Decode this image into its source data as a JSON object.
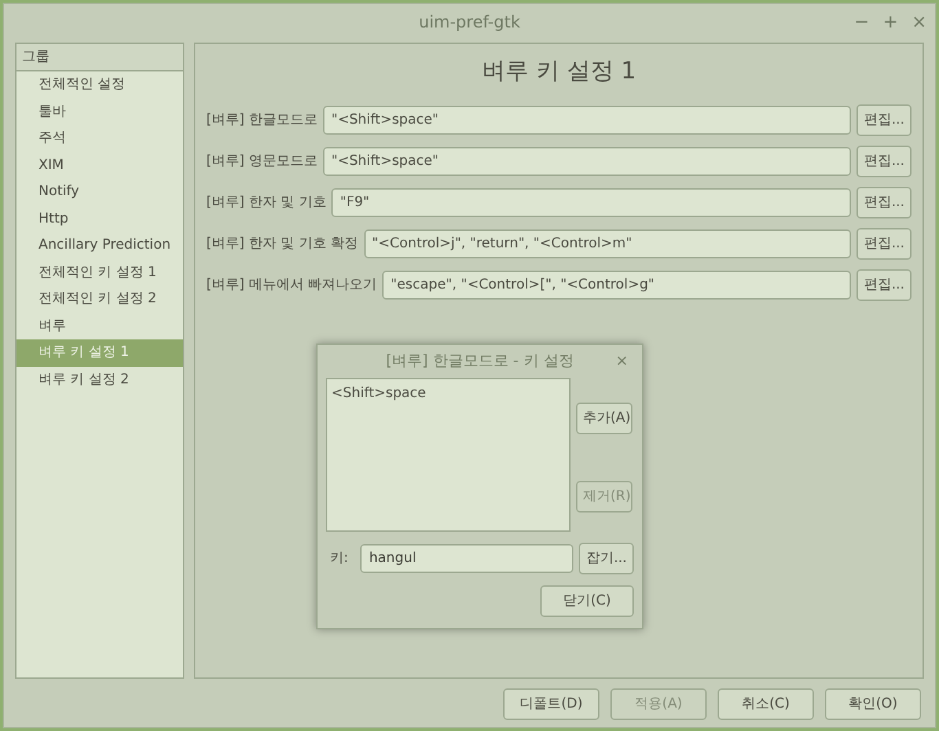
{
  "window": {
    "title": "uim-pref-gtk",
    "controls": [
      "−",
      "+",
      "×"
    ]
  },
  "sidebar": {
    "header": "그룹",
    "items": [
      {
        "label": "전체적인 설정",
        "selected": false
      },
      {
        "label": "툴바",
        "selected": false
      },
      {
        "label": "주석",
        "selected": false
      },
      {
        "label": "XIM",
        "selected": false
      },
      {
        "label": "Notify",
        "selected": false
      },
      {
        "label": "Http",
        "selected": false
      },
      {
        "label": "Ancillary Prediction",
        "selected": false
      },
      {
        "label": "전체적인 키 설정 1",
        "selected": false
      },
      {
        "label": "전체적인 키 설정 2",
        "selected": false
      },
      {
        "label": "벼루",
        "selected": false
      },
      {
        "label": "벼루 키 설정 1",
        "selected": true
      },
      {
        "label": "벼루 키 설정 2",
        "selected": false
      }
    ]
  },
  "main": {
    "heading": "벼루 키 설정 1",
    "settings": [
      {
        "label": "[벼루] 한글모드로",
        "value": "\"<Shift>space\"",
        "button": "편집..."
      },
      {
        "label": "[벼루] 영문모드로",
        "value": "\"<Shift>space\"",
        "button": "편집..."
      },
      {
        "label": "[벼루] 한자 및 기호",
        "value": "\"F9\"",
        "button": "편집..."
      },
      {
        "label": "[벼루] 한자 및 기호 확정",
        "value": "\"<Control>j\", \"return\", \"<Control>m\"",
        "button": "편집..."
      },
      {
        "label": "[벼루] 메뉴에서 빠져나오기",
        "value": "\"escape\", \"<Control>[\", \"<Control>g\"",
        "button": "편집..."
      }
    ]
  },
  "dialog": {
    "title": "[벼루] 한글모드로 - 키 설정",
    "close": "×",
    "keys": [
      "<Shift>space"
    ],
    "side_buttons": [
      {
        "label": "추가(A)",
        "disabled": false
      },
      {
        "label": "제거(R)",
        "disabled": true
      }
    ],
    "key_label": "키:",
    "key_value": "hangul",
    "grab_button": "잡기...",
    "close_button": "닫기(C)"
  },
  "footer": [
    {
      "label": "디폴트(D)",
      "disabled": false
    },
    {
      "label": "적용(A)",
      "disabled": true
    },
    {
      "label": "취소(C)",
      "disabled": false
    },
    {
      "label": "확인(O)",
      "disabled": false
    }
  ]
}
